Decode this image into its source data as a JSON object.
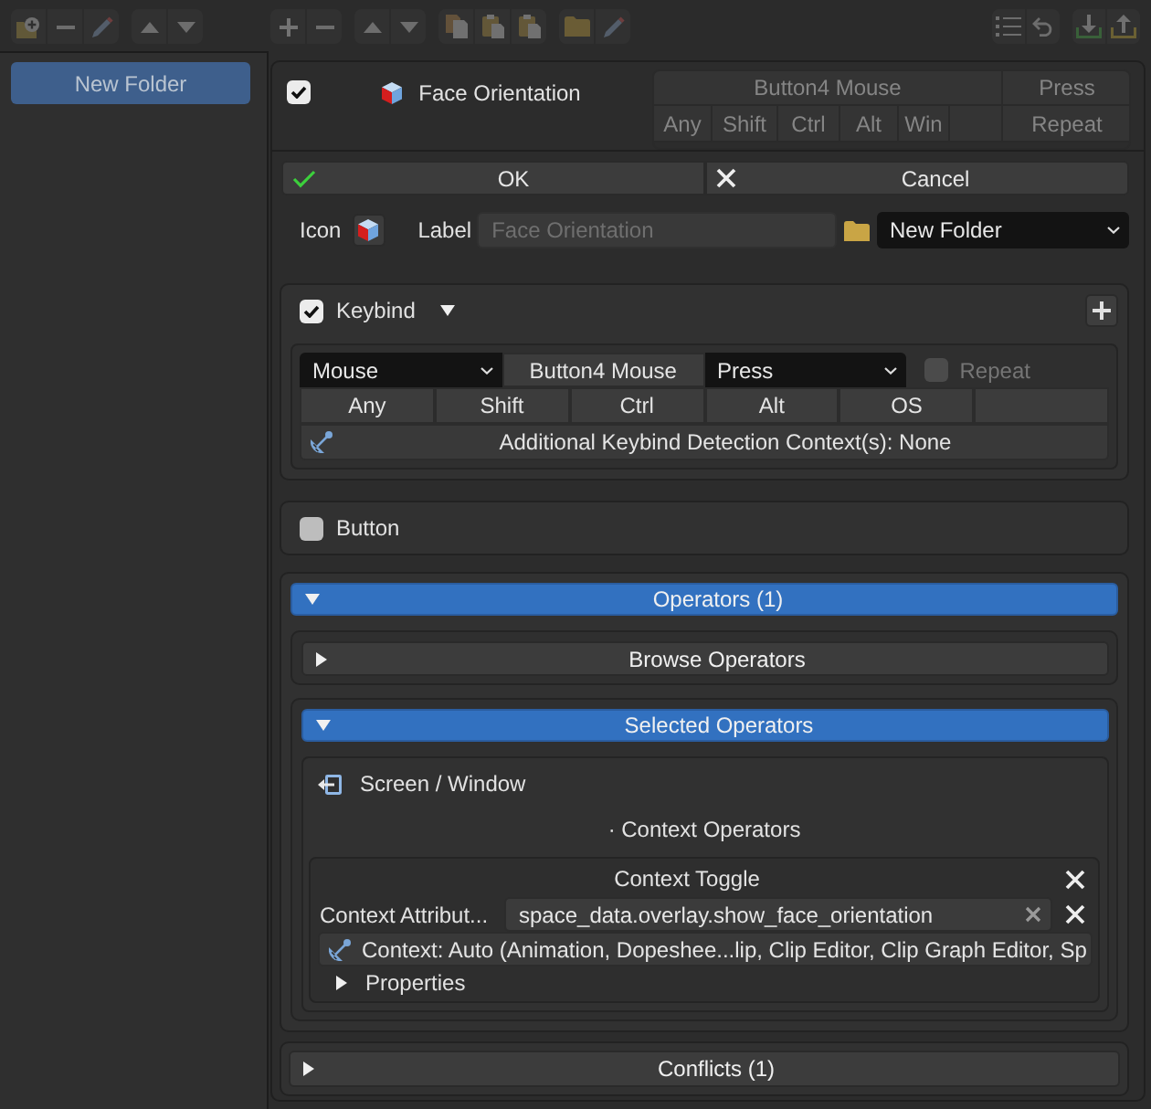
{
  "left_toolbar": {
    "disabled": true
  },
  "main_toolbar": {
    "disabled": true
  },
  "folders": [
    {
      "label": "New Folder",
      "selected": true
    }
  ],
  "item": {
    "checked": true,
    "title": "Face Orientation",
    "summary": {
      "disabled": true,
      "key": "Button4 Mouse",
      "event": "Press",
      "modifiers": [
        "Any",
        "Shift",
        "Ctrl",
        "Alt",
        "Win"
      ],
      "repeat": "Repeat"
    }
  },
  "actions": [
    {
      "kind": "confirm",
      "label": "OK"
    },
    {
      "kind": "cancel",
      "label": "Cancel"
    }
  ],
  "appearance": {
    "icon_label": "Icon",
    "label_label": "Label",
    "label_field": {
      "placeholder": "Face Orientation"
    },
    "folder_select": {
      "value": "New Folder"
    }
  },
  "keybind": {
    "checked": true,
    "title": "Keybind",
    "device": "Mouse",
    "key": "Button4 Mouse",
    "event": "Press",
    "repeat": {
      "label": "Repeat",
      "checked": false,
      "disabled": true
    },
    "modifiers": [
      {
        "label": "Any",
        "on": false
      },
      {
        "label": "Shift",
        "on": false
      },
      {
        "label": "Ctrl",
        "on": false
      },
      {
        "label": "Alt",
        "on": false
      },
      {
        "label": "OS",
        "on": false
      }
    ],
    "context": "Additional Keybind Detection Context(s): None"
  },
  "button": {
    "checked": false,
    "title": "Button"
  },
  "operators": {
    "title": "Operators (1)",
    "expanded": true,
    "browse": {
      "title": "Browse Operators",
      "expanded": false
    },
    "selected": {
      "title": "Selected Operators",
      "expanded": true,
      "category": "Screen / Window",
      "heading": "· Context Operators",
      "operator": {
        "title": "Context Toggle",
        "attribute_label": "Context Attribut...",
        "attribute_value": "space_data.overlay.show_face_orientation",
        "context": "Context: Auto (Animation, Dopeshee...lip, Clip Editor, Clip Graph Editor, Sp",
        "properties": {
          "title": "Properties",
          "expanded": false
        }
      }
    }
  },
  "conflicts": {
    "title": "Conflicts (1)",
    "expanded": false
  }
}
